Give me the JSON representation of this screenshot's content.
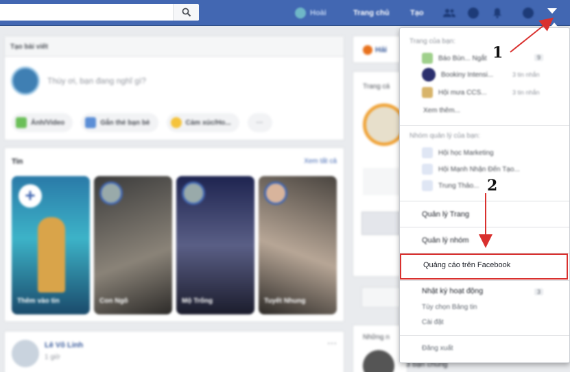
{
  "header": {
    "profile_name": "Hoài",
    "nav_home": "Trang chủ",
    "nav_create": "Tạo"
  },
  "composer": {
    "title": "Tạo bài viết",
    "placeholder": "Thùy ơi, bạn đang nghĩ gì?",
    "actions": [
      "Ảnh/Video",
      "Gắn thẻ bạn bè",
      "Cảm xúc/Ho..."
    ],
    "more": "···"
  },
  "stories": {
    "title": "Tin",
    "see_all": "Xem tất cả",
    "items": [
      "Thêm vào tin",
      "Con Ngô",
      "Mộ Trống",
      "Tuyết Nhung"
    ]
  },
  "post": {
    "author": "Lê Võ Linh",
    "time": "1 giờ",
    "more": "···"
  },
  "right_col": {
    "card1": "Hải",
    "card2": "Trang cá",
    "card3": "Những n",
    "friends_common": "3 bạn chung"
  },
  "dropdown": {
    "pages_title": "Trang của bạn:",
    "pages": [
      {
        "name": "Báo Bùn... Ngắt",
        "meta": "",
        "count": "9"
      },
      {
        "name": "Bookiny Intensi...",
        "meta": "3 tin nhắn",
        "count": ""
      },
      {
        "name": "Hội mưa CCS...",
        "meta": "3 tin nhắn",
        "count": ""
      }
    ],
    "see_more_pages": "Xem thêm...",
    "groups_title": "Nhóm quản lý của bạn:",
    "groups": [
      "Hội học Marketing",
      "Hội Mạnh Nhận Đến Tạo...",
      "Trung Thảo..."
    ],
    "manage_pages": "Quản lý Trang",
    "manage_groups": "Quản lý nhóm",
    "ads": "Quảng cáo trên Facebook",
    "activity_log": "Nhật ký hoạt động",
    "activity_count": "3",
    "news_feed_prefs": "Tùy chọn Bảng tin",
    "settings": "Cài đặt",
    "logout": "Đăng xuất"
  },
  "annotations": {
    "step1": "1",
    "step2": "2",
    "color": "#d9302e"
  }
}
